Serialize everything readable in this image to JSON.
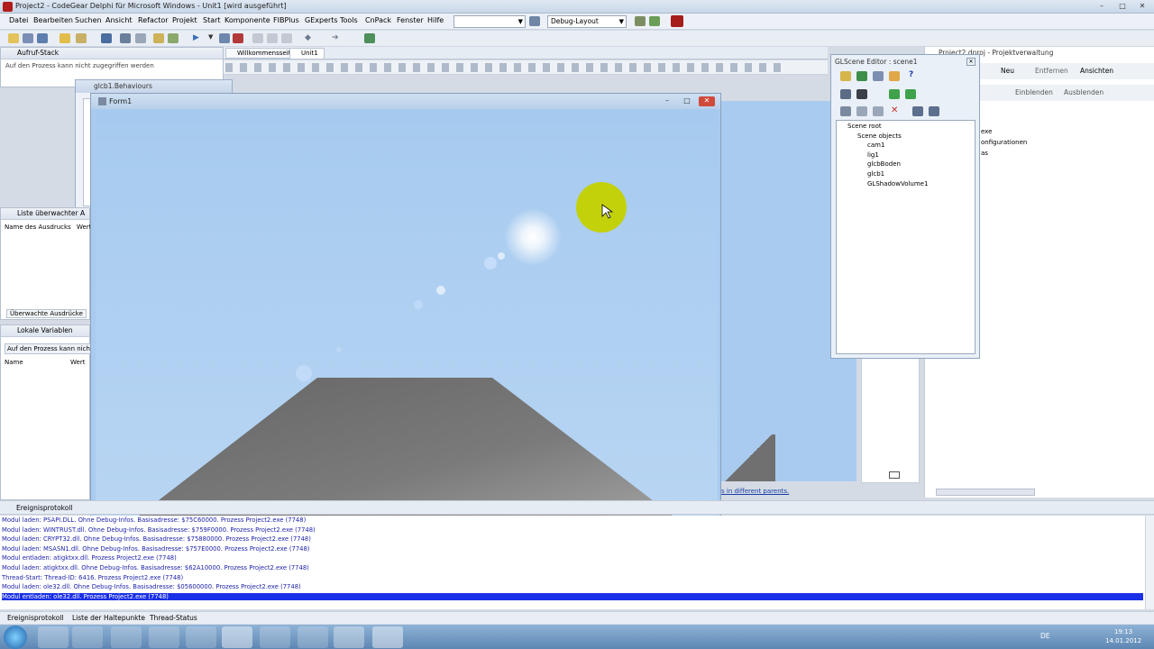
{
  "window": {
    "title": "Project2 - CodeGear Delphi für Microsoft Windows - Unit1 [wird ausgeführt]"
  },
  "menu": {
    "items": [
      "Datei",
      "Bearbeiten",
      "Suchen",
      "Ansicht",
      "Refactor",
      "Projekt",
      "Start",
      "Komponente",
      "FIBPlus",
      "GExperts",
      "Tools",
      "CnPack",
      "Fenster",
      "Hilfe"
    ],
    "layout_combo": "Debug-Layout"
  },
  "call_stack": {
    "title": "Aufruf-Stack",
    "message": "Auf den Prozess kann nicht zugegriffen werden"
  },
  "behaviours": {
    "title": "glcb1.Behaviours"
  },
  "editor_tabs": {
    "welcome": "Willkommensseite",
    "unit": "Unit1"
  },
  "watch": {
    "title": "Liste überwachter A",
    "col_name": "Name des Ausdrucks",
    "col_value": "Wert",
    "tab": "Überwachte Ausdrücke"
  },
  "locals": {
    "title": "Lokale Variablen",
    "message": "Auf den Prozess kann nicht z",
    "col_name": "Name",
    "col_value": "Wert"
  },
  "form1": {
    "title": "Form1"
  },
  "gl_editor": {
    "title": "GLScene Editor : scene1",
    "tree": [
      {
        "label": "Scene root",
        "level": 0
      },
      {
        "label": "Scene objects",
        "level": 1
      },
      {
        "label": "cam1",
        "level": 2
      },
      {
        "label": "lig1",
        "level": 2
      },
      {
        "label": "glcbBoden",
        "level": 2
      },
      {
        "label": "glcb1",
        "level": 2
      },
      {
        "label": "GLShadowVolume1",
        "level": 2
      }
    ]
  },
  "project_manager": {
    "title": "Project2.dproj - Projektverwaltung",
    "btn_new": "Neu",
    "btn_remove": "Entfernen",
    "btn_views": "Ansichten",
    "btn_show": "Einblenden",
    "btn_hide": "Ausblenden",
    "item_exe": "exe",
    "item_configs": "onfigurationen",
    "item_as": "as"
  },
  "hint_text": "s in different parents.",
  "event_log": {
    "title": "Ereignisprotokoll",
    "lines": [
      "Modul laden: PSAPI.DLL. Ohne Debug-Infos. Basisadresse: $75C60000. Prozess Project2.exe (7748)",
      "Modul laden: WINTRUST.dll. Ohne Debug-Infos. Basisadresse: $759F0000. Prozess Project2.exe (7748)",
      "Modul laden: CRYPT32.dll. Ohne Debug-Infos. Basisadresse: $75880000. Prozess Project2.exe (7748)",
      "Modul laden: MSASN1.dll. Ohne Debug-Infos. Basisadresse: $757E0000. Prozess Project2.exe (7748)",
      "Modul entladen: atigktxx.dll. Prozess Project2.exe (7748)",
      "Modul laden: atigktxx.dll. Ohne Debug-Infos. Basisadresse: $62A10000. Prozess Project2.exe (7748)",
      "Thread-Start: Thread-ID: 6416. Prozess Project2.exe (7748)",
      "Modul laden: ole32.dll. Ohne Debug-Infos. Basisadresse: $05600000. Prozess Project2.exe (7748)"
    ],
    "selected_line": "Modul entladen: ole32.dll. Prozess Project2.exe (7748)"
  },
  "bottom_tabs": [
    "Ereignisprotokoll",
    "Liste der Haltepunkte",
    "Thread-Status"
  ],
  "taskbar": {
    "lang": "DE",
    "time": "19:13",
    "date": "14.01.2012"
  },
  "colors": {
    "scene_sky": "#a9cbef",
    "selection": "#1a30e6",
    "log_text": "#1b1fa8"
  }
}
